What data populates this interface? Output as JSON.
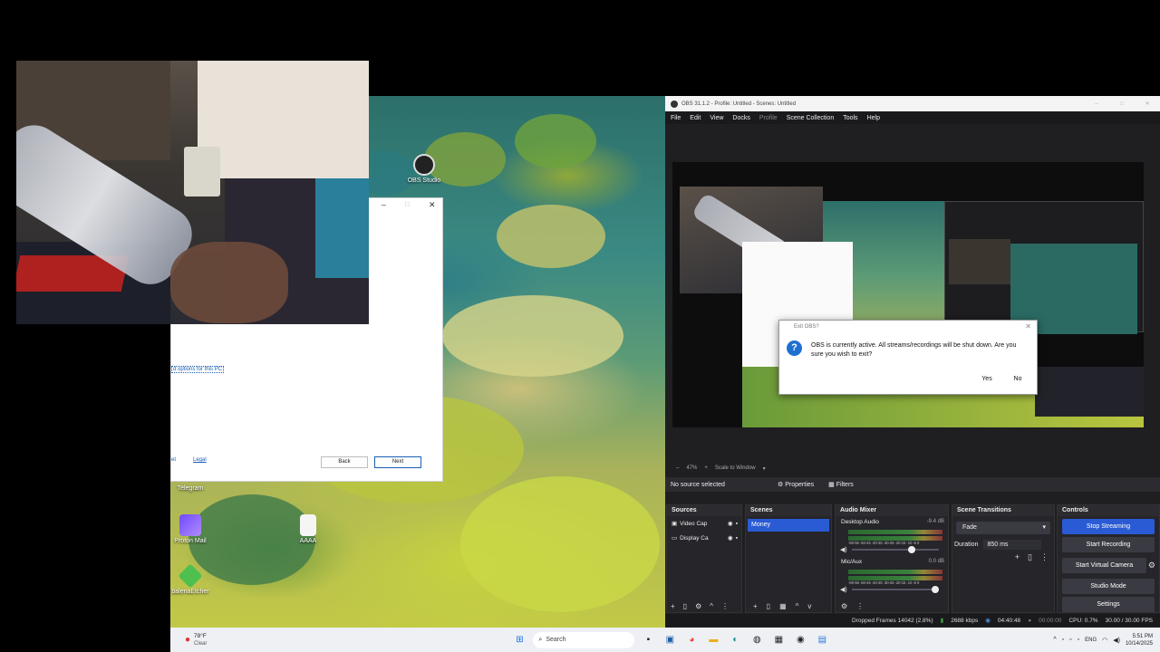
{
  "desktop": {
    "icons": [
      {
        "label": "OBS Studio"
      },
      {
        "label": "Telegram"
      },
      {
        "label": "Proton Mail"
      },
      {
        "label": "AAAA"
      },
      {
        "label": "balenaEtcher"
      }
    ]
  },
  "setup_window": {
    "link_text": "d options for this PC",
    "bottom_links": [
      "et",
      "Legal"
    ],
    "back_label": "Back",
    "next_label": "Next"
  },
  "obs": {
    "title": "OBS 31.1.2 - Profile: Untitled - Scenes: Untitled",
    "menu": [
      "File",
      "Edit",
      "View",
      "Docks",
      "Profile",
      "Scene Collection",
      "Tools",
      "Help"
    ],
    "zoom": "47%",
    "scale_mode": "Scale to Window",
    "no_source": "No source selected",
    "properties_label": "Properties",
    "filters_label": "Filters",
    "sources": {
      "title": "Sources",
      "items": [
        "Video Cap",
        "Display Ca"
      ]
    },
    "scenes": {
      "title": "Scenes",
      "items": [
        "Money"
      ]
    },
    "audio_mixer": {
      "title": "Audio Mixer",
      "channels": [
        {
          "name": "Desktop Audio",
          "db": "-9.4 dB"
        },
        {
          "name": "Mic/Aux",
          "db": "0.0 dB"
        }
      ],
      "tick_labels": "-60-55 -50-45 -40-35 -30-25 -20-15 -10 -5  0"
    },
    "transitions": {
      "title": "Scene Transitions",
      "selected": "Fade",
      "duration_label": "Duration",
      "duration_value": "850 ms"
    },
    "controls": {
      "title": "Controls",
      "buttons": [
        "Stop Streaming",
        "Start Recording",
        "Start Virtual Camera",
        "Studio Mode",
        "Settings"
      ]
    },
    "status": {
      "dropped": "Dropped Frames 14042 (2.8%)",
      "bitrate": "2688 kbps",
      "stream_time": "04:40:48",
      "rec_time": "00:00:00",
      "cpu": "CPU: 0.7%",
      "fps": "30.00 / 30.00 FPS"
    },
    "exit_dialog": {
      "title": "Exit OBS?",
      "message": "OBS is currently active. All streams/recordings will be shut down. Are you sure you wish to exit?",
      "yes_label": "Yes",
      "no_label": "No"
    }
  },
  "taskbar": {
    "weather_temp": "78°F",
    "weather_cond": "Clear",
    "search_label": "Search",
    "lang": "ENG",
    "time": "5:51 PM",
    "date": "10/14/2025"
  },
  "colors": {
    "obs_accent": "#2a5bd4",
    "obs_bg": "#1f1f22",
    "taskbar_bg": "#eef0f4"
  }
}
